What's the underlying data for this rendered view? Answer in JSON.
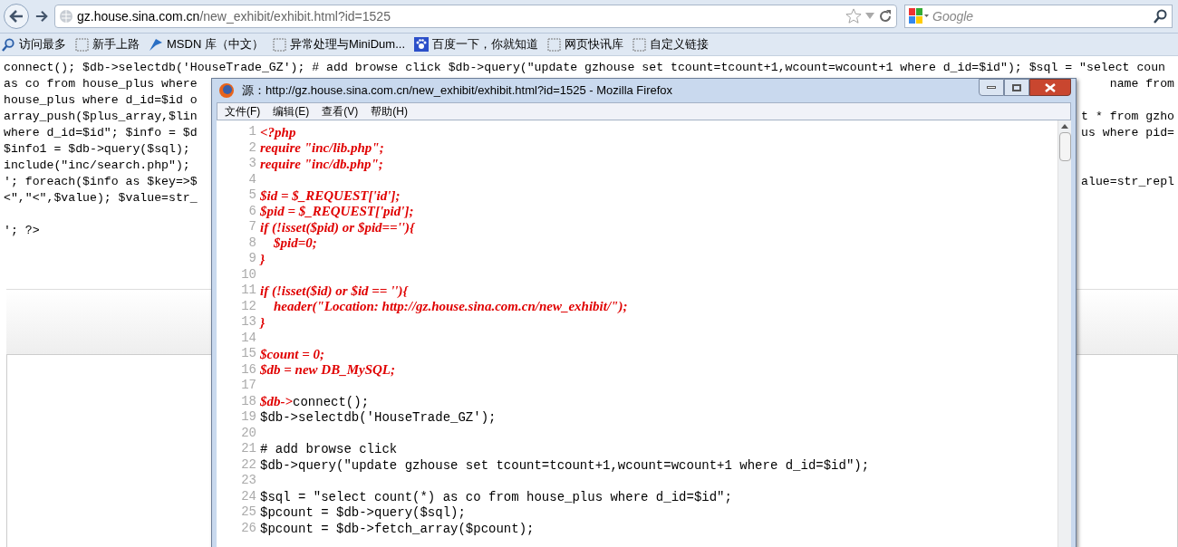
{
  "browser": {
    "url_host": "gz.house.sina.com.cn",
    "url_path": "/new_exhibit/exhibit.html?id=1525",
    "search_placeholder": "Google"
  },
  "bookmarks": [
    {
      "label": "访问最多"
    },
    {
      "label": "新手上路"
    },
    {
      "label": "MSDN 库（中文）"
    },
    {
      "label": "异常处理与MiniDum..."
    },
    {
      "label": "百度一下，你就知道"
    },
    {
      "label": "网页快讯库"
    },
    {
      "label": "自定义链接"
    }
  ],
  "page_text": {
    "full_line": "connect(); $db->selectdb('HouseTrade_GZ'); # add browse click $db->query(\"update gzhouse set tcount=tcount+1,wcount=wcount+1 where d_id=$id\"); $sql = \"select coun",
    "rows": [
      {
        "left": "as co from house_plus where",
        "right": "name from"
      },
      {
        "left": "house_plus where d_id=$id o"
      },
      {
        "left": "array_push($plus_array,$lin",
        "right": "t * from gzho"
      },
      {
        "left": "where d_id=$id\"; $info = $d",
        "right": "us where pid="
      },
      {
        "left": "$info1 = $db->query($sql);"
      },
      {
        "left": "include(\"inc/search.php\");"
      },
      {
        "left": "'; foreach($info as $key=>$",
        "right": "alue=str_repl"
      },
      {
        "left": "<\",\"<\",$value); $value=str_"
      }
    ],
    "closing_line": "'; ?>"
  },
  "source_window": {
    "title": "源：http://gz.house.sina.com.cn/new_exhibit/exhibit.html?id=1525 - Mozilla Firefox",
    "menu": [
      "文件(F)",
      "编辑(E)",
      "查看(V)",
      "帮助(H)"
    ],
    "lines": [
      {
        "number": "1",
        "segments": [
          {
            "kind": "php",
            "text": "<?php"
          }
        ]
      },
      {
        "number": "2",
        "segments": [
          {
            "kind": "php",
            "text": "require \"inc/lib.php\";"
          }
        ]
      },
      {
        "number": "3",
        "segments": [
          {
            "kind": "php",
            "text": "require \"inc/db.php\";"
          }
        ]
      },
      {
        "number": "4"
      },
      {
        "number": "5",
        "segments": [
          {
            "kind": "php",
            "text": "$id = $_REQUEST['id'];"
          }
        ]
      },
      {
        "number": "6",
        "segments": [
          {
            "kind": "php",
            "text": "$pid = $_REQUEST['pid'];"
          }
        ]
      },
      {
        "number": "7",
        "segments": [
          {
            "kind": "php",
            "text": "if (!isset($pid) or $pid==''){"
          }
        ]
      },
      {
        "number": "8",
        "segments": [
          {
            "kind": "php",
            "text": "    $pid=0;"
          }
        ]
      },
      {
        "number": "9",
        "segments": [
          {
            "kind": "php",
            "text": "}"
          }
        ]
      },
      {
        "number": "10"
      },
      {
        "number": "11",
        "segments": [
          {
            "kind": "php",
            "text": "if (!isset($id) or $id == ''){"
          }
        ]
      },
      {
        "number": "12",
        "segments": [
          {
            "kind": "php",
            "text": "    header(\"Location: http://gz.house.sina.com.cn/new_exhibit/\");"
          }
        ]
      },
      {
        "number": "13",
        "segments": [
          {
            "kind": "php",
            "text": "}"
          }
        ]
      },
      {
        "number": "14"
      },
      {
        "number": "15",
        "segments": [
          {
            "kind": "php",
            "text": "$count = 0;"
          }
        ]
      },
      {
        "number": "16",
        "segments": [
          {
            "kind": "php",
            "text": "$db = new DB_MySQL;"
          }
        ]
      },
      {
        "number": "17"
      },
      {
        "number": "18",
        "segments": [
          {
            "kind": "php",
            "text": "$db->"
          },
          {
            "kind": "plain",
            "text": "connect();"
          }
        ]
      },
      {
        "number": "19",
        "segments": [
          {
            "kind": "plain",
            "text": "$db->selectdb('HouseTrade_GZ');"
          }
        ]
      },
      {
        "number": "20"
      },
      {
        "number": "21",
        "segments": [
          {
            "kind": "plain",
            "text": "# add browse click"
          }
        ]
      },
      {
        "number": "22",
        "segments": [
          {
            "kind": "plain",
            "text": "$db->query(\"update gzhouse set tcount=tcount+1,wcount=wcount+1 where d_id=$id\");"
          }
        ]
      },
      {
        "number": "23"
      },
      {
        "number": "24",
        "segments": [
          {
            "kind": "plain",
            "text": "$sql = \"select count(*) as co from house_plus where d_id=$id\";"
          }
        ]
      },
      {
        "number": "25",
        "segments": [
          {
            "kind": "plain",
            "text": "$pcount = $db->query($sql);"
          }
        ]
      },
      {
        "number": "26",
        "segments": [
          {
            "kind": "plain",
            "text": "$pcount = $db->fetch_array($pcount);"
          }
        ]
      }
    ]
  }
}
